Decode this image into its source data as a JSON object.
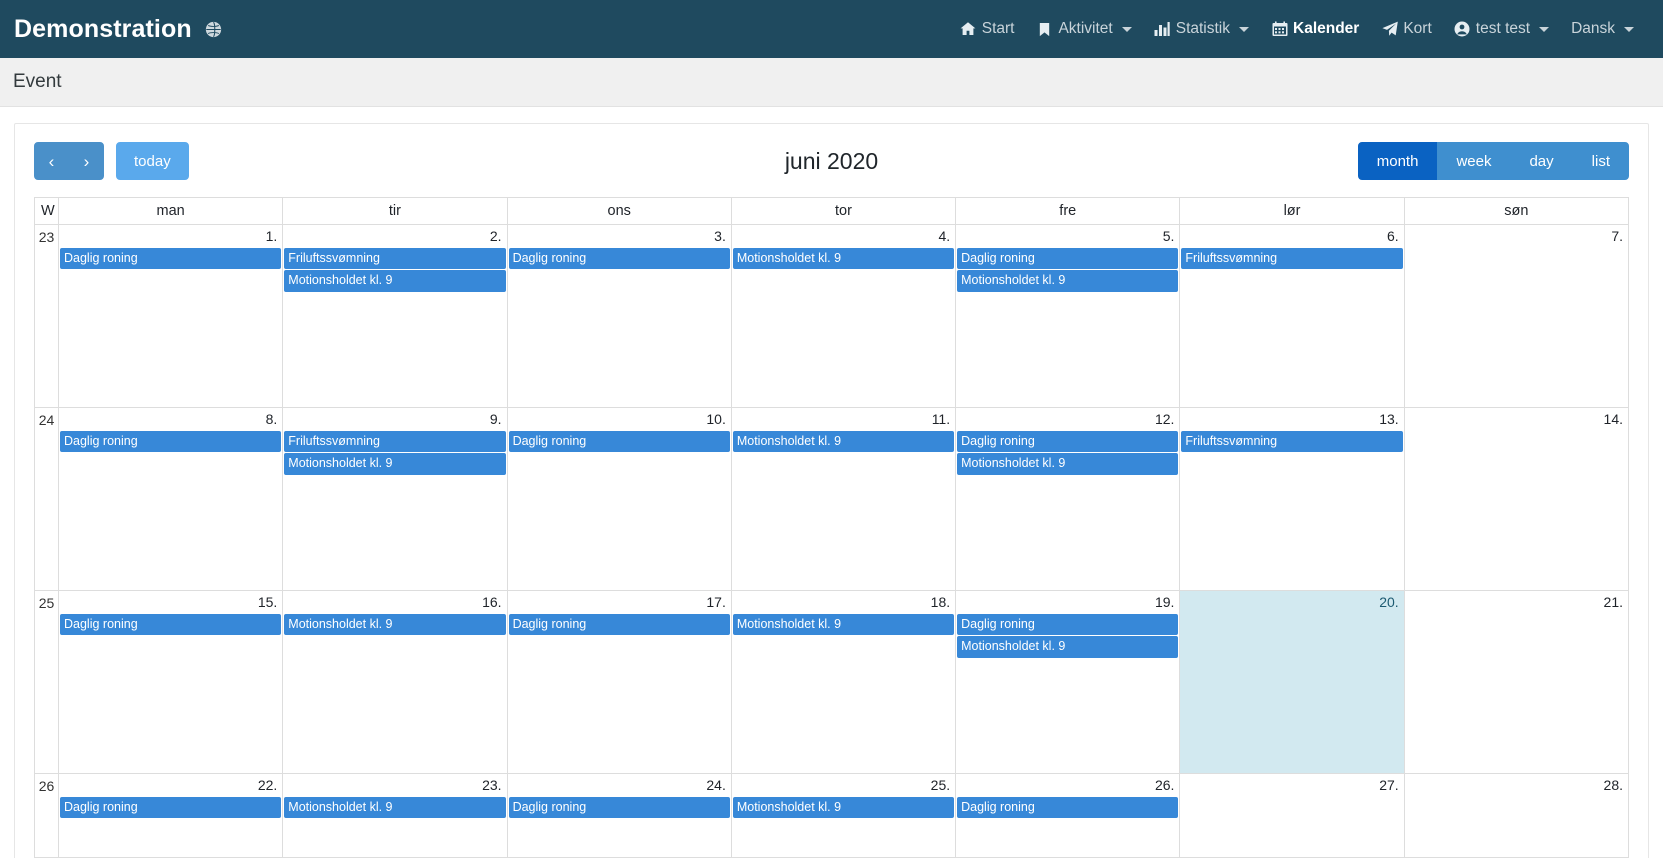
{
  "navbar": {
    "brand": "Demonstration",
    "brand_icon": "globe-icon",
    "items": [
      {
        "label": "Start",
        "icon": "home-icon",
        "caret": false,
        "active": false
      },
      {
        "label": "Aktivitet",
        "icon": "bookmark-icon",
        "caret": true,
        "active": false
      },
      {
        "label": "Statistik",
        "icon": "chart-bar-icon",
        "caret": true,
        "active": false
      },
      {
        "label": "Kalender",
        "icon": "calendar-icon",
        "caret": false,
        "active": true
      },
      {
        "label": "Kort",
        "icon": "paper-plane-icon",
        "caret": false,
        "active": false
      },
      {
        "label": "test test",
        "icon": "user-circle-icon",
        "caret": true,
        "active": false
      },
      {
        "label": "Dansk",
        "icon": "",
        "caret": true,
        "active": false
      }
    ]
  },
  "subheader": {
    "title": "Event"
  },
  "toolbar": {
    "prev_label": "‹",
    "next_label": "›",
    "today_label": "today",
    "title": "juni 2020",
    "views": [
      {
        "label": "month",
        "active": true
      },
      {
        "label": "week",
        "active": false
      },
      {
        "label": "day",
        "active": false
      },
      {
        "label": "list",
        "active": false
      }
    ]
  },
  "calendar": {
    "week_header": "W",
    "day_headers": [
      "man",
      "tir",
      "ons",
      "tor",
      "fre",
      "lør",
      "søn"
    ],
    "colors": {
      "event_bg": "#3788d8",
      "today_bg": "#d2e9f0",
      "navbar_bg": "#1f4a5f",
      "active_view_bg": "#0a62c2"
    },
    "weeks": [
      {
        "number": "23",
        "days": [
          {
            "num": "1.",
            "today": false,
            "events": [
              "Daglig roning"
            ]
          },
          {
            "num": "2.",
            "today": false,
            "events": [
              "Friluftssvømning",
              "Motionsholdet kl. 9"
            ]
          },
          {
            "num": "3.",
            "today": false,
            "events": [
              "Daglig roning"
            ]
          },
          {
            "num": "4.",
            "today": false,
            "events": [
              "Motionsholdet kl. 9"
            ]
          },
          {
            "num": "5.",
            "today": false,
            "events": [
              "Daglig roning",
              "Motionsholdet kl. 9"
            ]
          },
          {
            "num": "6.",
            "today": false,
            "events": [
              "Friluftssvømning"
            ]
          },
          {
            "num": "7.",
            "today": false,
            "events": []
          }
        ]
      },
      {
        "number": "24",
        "days": [
          {
            "num": "8.",
            "today": false,
            "events": [
              "Daglig roning"
            ]
          },
          {
            "num": "9.",
            "today": false,
            "events": [
              "Friluftssvømning",
              "Motionsholdet kl. 9"
            ]
          },
          {
            "num": "10.",
            "today": false,
            "events": [
              "Daglig roning"
            ]
          },
          {
            "num": "11.",
            "today": false,
            "events": [
              "Motionsholdet kl. 9"
            ]
          },
          {
            "num": "12.",
            "today": false,
            "events": [
              "Daglig roning",
              "Motionsholdet kl. 9"
            ]
          },
          {
            "num": "13.",
            "today": false,
            "events": [
              "Friluftssvømning"
            ]
          },
          {
            "num": "14.",
            "today": false,
            "events": []
          }
        ]
      },
      {
        "number": "25",
        "days": [
          {
            "num": "15.",
            "today": false,
            "events": [
              "Daglig roning"
            ]
          },
          {
            "num": "16.",
            "today": false,
            "events": [
              "Motionsholdet kl. 9"
            ]
          },
          {
            "num": "17.",
            "today": false,
            "events": [
              "Daglig roning"
            ]
          },
          {
            "num": "18.",
            "today": false,
            "events": [
              "Motionsholdet kl. 9"
            ]
          },
          {
            "num": "19.",
            "today": false,
            "events": [
              "Daglig roning",
              "Motionsholdet kl. 9"
            ]
          },
          {
            "num": "20.",
            "today": true,
            "events": []
          },
          {
            "num": "21.",
            "today": false,
            "events": []
          }
        ]
      },
      {
        "number": "26",
        "days": [
          {
            "num": "22.",
            "today": false,
            "events": [
              "Daglig roning"
            ]
          },
          {
            "num": "23.",
            "today": false,
            "events": [
              "Motionsholdet kl. 9"
            ]
          },
          {
            "num": "24.",
            "today": false,
            "events": [
              "Daglig roning"
            ]
          },
          {
            "num": "25.",
            "today": false,
            "events": [
              "Motionsholdet kl. 9"
            ]
          },
          {
            "num": "26.",
            "today": false,
            "events": [
              "Daglig roning"
            ]
          },
          {
            "num": "27.",
            "today": false,
            "events": []
          },
          {
            "num": "28.",
            "today": false,
            "events": []
          }
        ]
      }
    ]
  }
}
